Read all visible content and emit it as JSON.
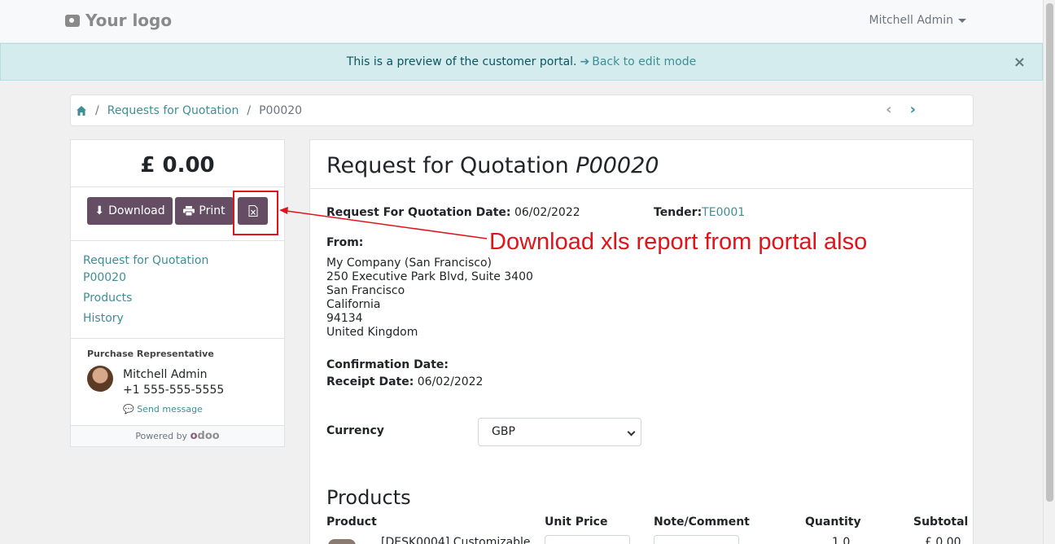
{
  "header": {
    "logo_text": "Your logo",
    "user_name": "Mitchell Admin"
  },
  "preview_bar": {
    "message": "This is a preview of the customer portal.",
    "link_label": "Back to edit mode",
    "close_label": "×"
  },
  "breadcrumb": {
    "items": [
      "Requests for Quotation",
      "P00020"
    ]
  },
  "sidebar": {
    "amount": "£ 0.00",
    "download_label": "Download",
    "print_label": "Print",
    "nav": [
      "Request for Quotation",
      "P00020",
      "Products",
      "History"
    ],
    "rep_title": "Purchase Representative",
    "rep_name": "Mitchell Admin",
    "rep_phone": "+1 555-555-5555",
    "send_message": "Send message",
    "powered_by": "Powered by"
  },
  "main": {
    "title_prefix": "Request for Quotation",
    "title_ref": "P00020",
    "rfq_date_label": "Request For Quotation Date:",
    "rfq_date": "06/02/2022",
    "tender_label": "Tender:",
    "tender_value": "TE0001",
    "from_label": "From:",
    "address": [
      "My Company (San Francisco)",
      "250 Executive Park Blvd, Suite 3400",
      "San Francisco",
      "California",
      "94134",
      "United Kingdom"
    ],
    "confirmation_label": "Confirmation Date:",
    "receipt_label": "Receipt Date:",
    "receipt_date": "06/02/2022",
    "currency_label": "Currency",
    "currency_value": "GBP",
    "products_title": "Products",
    "columns": [
      "Product",
      "Unit Price",
      "Note/Comment",
      "Quantity",
      "Subtotal"
    ],
    "row": {
      "product": "[DESK0004] Customizable",
      "quantity": "1.0",
      "subtotal": "£ 0.00"
    }
  },
  "annotation": {
    "text": "Download xls report from portal also"
  },
  "colors": {
    "accent": "#3c8f96",
    "button": "#654e64",
    "annotation": "#e0141a"
  }
}
